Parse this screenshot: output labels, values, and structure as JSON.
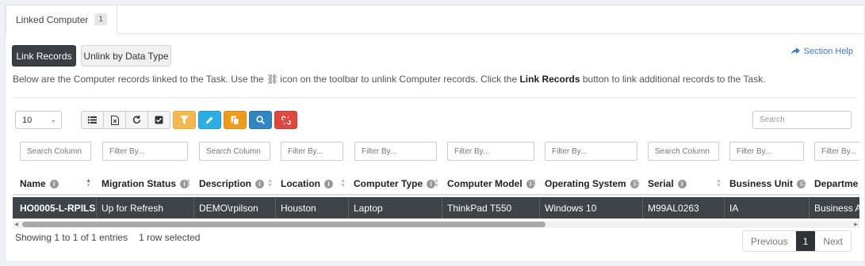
{
  "tab": {
    "label": "Linked Computer",
    "count": "1"
  },
  "buttons": {
    "link_records": "Link Records",
    "unlink_by_data_type": "Unlink by Data Type"
  },
  "section_help": "Section Help",
  "intro": {
    "part1": "Below are the Computer records linked to the Task. Use the",
    "part2": "icon on the toolbar to unlink Computer records. Click the",
    "bold": "Link Records",
    "part3": "button to link additional records to the Task."
  },
  "page_length": "10",
  "search_placeholder": "Search",
  "filters": [
    "Search Column",
    "Filter By...",
    "Search Column",
    "Filter By...",
    "Filter By...",
    "Filter By...",
    "Filter By...",
    "Search Column",
    "Filter By...",
    "Filter By..."
  ],
  "columns": [
    "Name",
    "Migration Status",
    "Description",
    "Location",
    "Computer Type",
    "Computer Model",
    "Operating System",
    "Serial",
    "Business Unit",
    "Departme"
  ],
  "row": [
    "HO0005-L-RPILS",
    "Up for Refresh",
    "DEMO\\rpilson",
    "Houston",
    "Laptop",
    "ThinkPad T550",
    "Windows 10",
    "M99AL0263",
    "IA",
    "Business A"
  ],
  "footer": {
    "showing": "Showing 1 to 1 of 1 entries",
    "selected": "1 row selected"
  },
  "pager": {
    "previous": "Previous",
    "page": "1",
    "next": "Next"
  },
  "icons": [
    "list-icon",
    "export-excel-icon",
    "refresh-icon",
    "check-square-icon",
    "filter-icon",
    "edit-icon",
    "copy-icon",
    "search-icon",
    "unlink-icon"
  ],
  "colors": {
    "filter": "#f3b94f",
    "edit": "#2aaee3",
    "copy": "#f29a1c",
    "zoom": "#2f86c3",
    "unlink": "#e0483d",
    "selected_row": "#3e4348",
    "help_link": "#3a7cc4"
  }
}
